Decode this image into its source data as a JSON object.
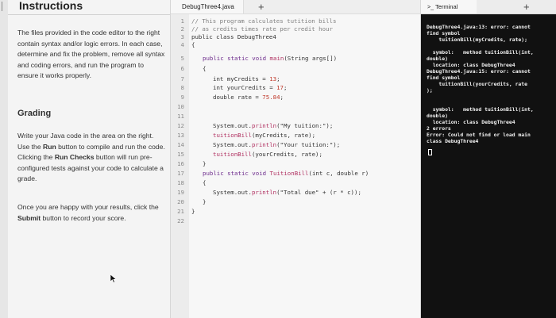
{
  "instructions": {
    "title": "Instructions",
    "para1": "The files provided in the code editor to the right contain syntax and/or logic errors. In each case, determine and fix the problem, remove all syntax and coding errors, and run the program to ensure it works properly.",
    "grading_title": "Grading",
    "para2_a": "Write your Java code in the area on the right. Use the ",
    "para2_run": "Run",
    "para2_b": " button to compile and run the code. Clicking the ",
    "para2_checks": "Run Checks",
    "para2_c": " button will run pre-configured tests against your code to calculate a grade.",
    "para3_a": "Once you are happy with your results, click the ",
    "para3_submit": "Submit",
    "para3_b": " button to record your score."
  },
  "editor": {
    "tab_label": "DebugThree4.java",
    "add_tab": "+",
    "line_numbers": [
      "1",
      "2",
      "3",
      "4",
      "5",
      "6",
      "7",
      "8",
      "9",
      "10",
      "11",
      "12",
      "13",
      "14",
      "15",
      "16",
      "17",
      "18",
      "19",
      "20",
      "21",
      "22"
    ],
    "code": {
      "l1": "// This program calculates tutition bills",
      "l2": "// as credits times rate per credit hour",
      "l3": "public class DebugThree4",
      "l4": "{",
      "l5_a": "public static void ",
      "l5_b": "main",
      "l5_c": "(String args[])",
      "l6": "{",
      "l7_a": "int myCredits = ",
      "l7_b": "13",
      "l7_c": ";",
      "l8_a": "int yourCredits = ",
      "l8_b": "17",
      "l8_c": ";",
      "l9_a": "double rate = ",
      "l9_b": "75.84",
      "l9_c": ";",
      "l12_a": "System.out.",
      "l12_b": "println",
      "l12_c": "(\"My tuition:\");",
      "l13_a": "tuitionBill",
      "l13_b": "(myCredits, rate);",
      "l14_a": "System.out.",
      "l14_b": "println",
      "l14_c": "(\"Your tuition:\");",
      "l15_a": "tuitionBill",
      "l15_b": "(yourCredits, rate);",
      "l16": "}",
      "l17_a": "public static void ",
      "l17_b": "TuitionBill",
      "l17_c": "(int c, double r)",
      "l18": "{",
      "l19_a": "System.out.",
      "l19_b": "println",
      "l19_c": "(\"Total due\" + (r * c));",
      "l20": "}",
      "l21": "}"
    }
  },
  "terminal": {
    "tab_label": "Terminal",
    "add_tab": "+",
    "lines": [
      "DebugThree4.java:13: error: cannot",
      "find symbol",
      "    tuitionBill(myCredits, rate);",
      "",
      "  symbol:   method tuitionBill(int,",
      "double)",
      "  location: class DebugThree4",
      "DebugThree4.java:15: error: cannot",
      "find symbol",
      "    tuitionBill(yourCredits, rate",
      ");",
      "",
      "  symbol:   method tuitionBill(int,",
      "double)",
      "  location: class DebugThree4",
      "2 errors",
      "Error: Could not find or load main",
      "class DebugThree4"
    ]
  }
}
